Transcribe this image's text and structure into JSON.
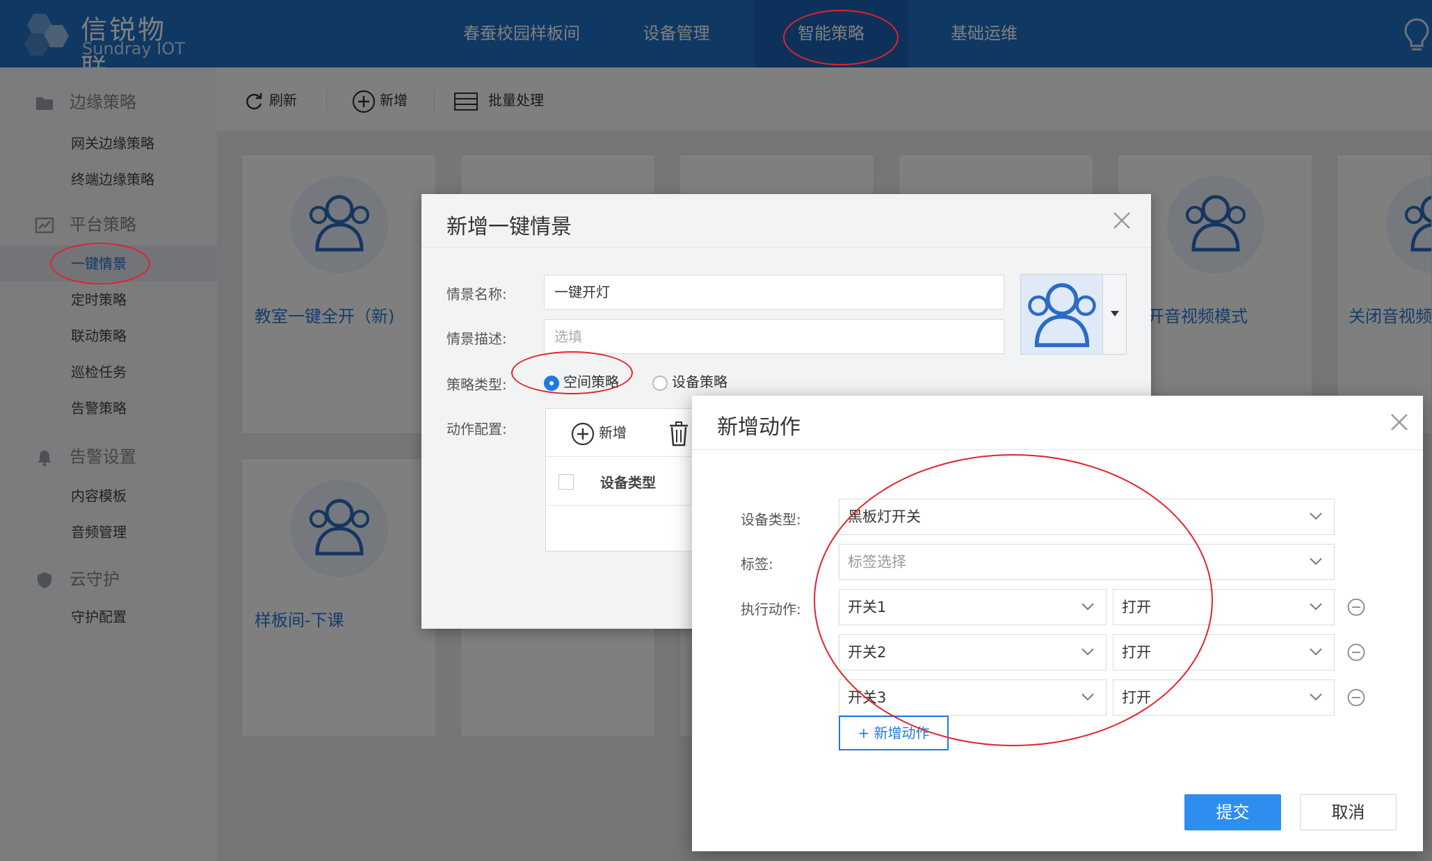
{
  "brand": {
    "name_cn": "信锐物联",
    "name_en": "Sundray IOT"
  },
  "nav": {
    "items": [
      {
        "label": "春蚕校园样板间"
      },
      {
        "label": "设备管理"
      },
      {
        "label": "智能策略"
      },
      {
        "label": "基础运维"
      }
    ],
    "active_index": 2,
    "bulb_icon": "lightbulb-icon"
  },
  "sidebar": {
    "groups": [
      {
        "label": "边缘策略",
        "icon": "folder-icon",
        "items": [
          "网关边缘策略",
          "终端边缘策略"
        ]
      },
      {
        "label": "平台策略",
        "icon": "chart-icon",
        "items": [
          "一键情景",
          "定时策略",
          "联动策略",
          "巡检任务",
          "告警策略"
        ]
      },
      {
        "label": "告警设置",
        "icon": "bell-icon",
        "items": [
          "内容模板",
          "音频管理"
        ]
      },
      {
        "label": "云守护",
        "icon": "shield-icon",
        "items": [
          "守护配置"
        ]
      }
    ],
    "active_item": "一键情景"
  },
  "toolbar": {
    "refresh": "刷新",
    "add": "新增",
    "batch": "批量处理"
  },
  "cards": [
    {
      "title": "教室一键全开（新)"
    },
    {
      "title": "开音视频模式"
    },
    {
      "title": "关闭音视频"
    },
    {
      "title": "样板间-下课"
    }
  ],
  "dialog_scene": {
    "title": "新增一键情景",
    "name_label": "情景名称:",
    "name_value": "一键开灯",
    "desc_label": "情景描述:",
    "desc_placeholder": "选填",
    "type_label": "策略类型:",
    "type_options": [
      "空间策略",
      "设备策略"
    ],
    "type_selected": "空间策略",
    "action_label": "动作配置:",
    "action_add": "新增",
    "action_col": "设备类型"
  },
  "dialog_action": {
    "title": "新增动作",
    "device_type_label": "设备类型:",
    "device_type_value": "黑板灯开关",
    "tag_label": "标签:",
    "tag_placeholder": "标签选择",
    "exec_label": "执行动作:",
    "rows": [
      {
        "switch": "开关1",
        "action": "打开"
      },
      {
        "switch": "开关2",
        "action": "打开"
      },
      {
        "switch": "开关3",
        "action": "打开"
      }
    ],
    "add_action": "+ 新增动作",
    "submit": "提交",
    "cancel": "取消"
  },
  "colors": {
    "nav_bg": "#1f70c6",
    "accent": "#1e7ae0",
    "submit": "#2e8ef0",
    "annotation": "#e2232b"
  }
}
